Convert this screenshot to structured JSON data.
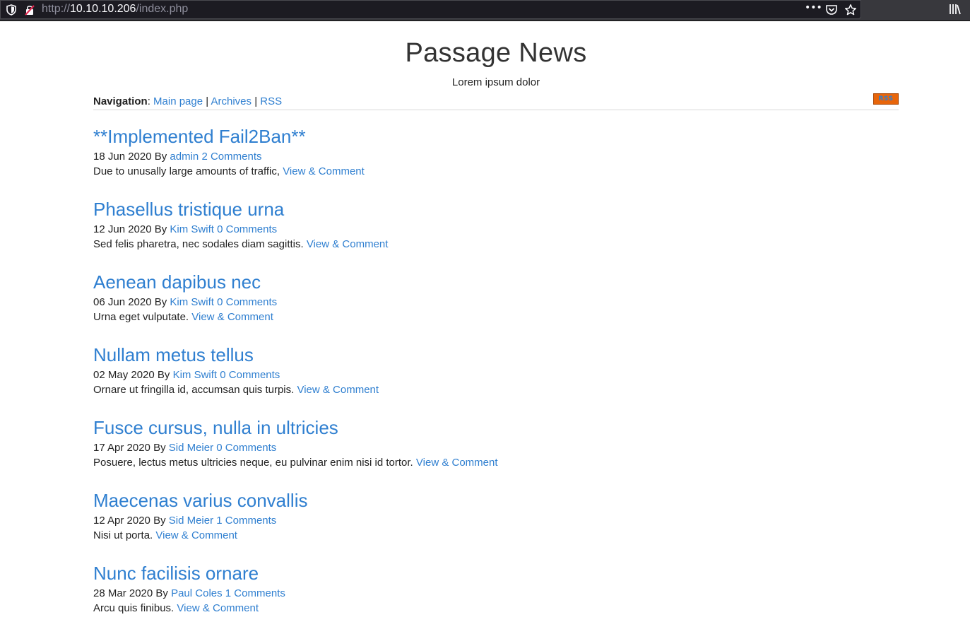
{
  "browser": {
    "url_scheme": "http://",
    "url_host": "10.10.10.206",
    "url_path": "/index.php",
    "icons": [
      "shield-icon",
      "insecure-lock-icon",
      "page-actions-icon",
      "pocket-icon",
      "bookmark-star-icon",
      "library-icon"
    ]
  },
  "site": {
    "title": "Passage News",
    "subtitle": "Lorem ipsum dolor"
  },
  "nav": {
    "label": "Navigation",
    "colon": ": ",
    "items": [
      "Main page",
      "Archives",
      "RSS"
    ],
    "separator": " | ",
    "rss_badge": "RSS"
  },
  "posts": [
    {
      "title": "**Implemented Fail2Ban**",
      "date": "18 Jun 2020",
      "by": " By ",
      "author": "admin",
      "comments": "2 Comments",
      "excerpt": "Due to unusally large amounts of traffic,",
      "link": "View & Comment"
    },
    {
      "title": "Phasellus tristique urna",
      "date": "12 Jun 2020",
      "by": " By ",
      "author": "Kim Swift",
      "comments": "0 Comments",
      "excerpt": "Sed felis pharetra, nec sodales diam sagittis.",
      "link": "View & Comment"
    },
    {
      "title": "Aenean dapibus nec",
      "date": "06 Jun 2020",
      "by": " By ",
      "author": "Kim Swift",
      "comments": "0 Comments",
      "excerpt": "Urna eget vulputate.",
      "link": "View & Comment"
    },
    {
      "title": "Nullam metus tellus",
      "date": "02 May 2020",
      "by": " By ",
      "author": "Kim Swift",
      "comments": "0 Comments",
      "excerpt": "Ornare ut fringilla id, accumsan quis turpis.",
      "link": "View & Comment"
    },
    {
      "title": "Fusce cursus, nulla in ultricies",
      "date": "17 Apr 2020",
      "by": " By ",
      "author": "Sid Meier",
      "comments": "0 Comments",
      "excerpt": "Posuere, lectus metus ultricies neque, eu pulvinar enim nisi id tortor.",
      "link": "View & Comment"
    },
    {
      "title": "Maecenas varius convallis",
      "date": "12 Apr 2020",
      "by": " By ",
      "author": "Sid Meier",
      "comments": "1 Comments",
      "excerpt": "Nisi ut porta.",
      "link": "View & Comment"
    },
    {
      "title": "Nunc facilisis ornare",
      "date": "28 Mar 2020",
      "by": " By ",
      "author": "Paul Coles",
      "comments": "1 Comments",
      "excerpt": "Arcu quis finibus.",
      "link": "View & Comment"
    }
  ]
}
